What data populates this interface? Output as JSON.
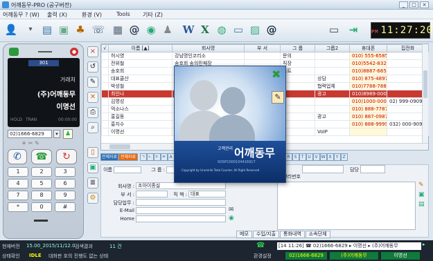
{
  "window": {
    "title": "어깨동무-PRO (공구버전)",
    "controls": [
      "_",
      "□",
      "×"
    ]
  },
  "menu": [
    {
      "label": "어깨동무 ? (W)"
    },
    {
      "label": "출력 (X)"
    },
    {
      "label": "환경 (V)"
    },
    {
      "label": "Tools"
    },
    {
      "label": "기타 (Z)"
    }
  ],
  "toolbar": {
    "clock": {
      "ampm": "PM",
      "time": "11:27:20"
    }
  },
  "phone": {
    "line": "301",
    "state": "거래처",
    "company": "(주)어깨동무",
    "contact": "이명선",
    "hold": "HOLD",
    "tran": "TRAN",
    "timer": "00:00:00",
    "number": "02)1666-6829",
    "keys": [
      "1",
      "2",
      "3",
      "4",
      "5",
      "6",
      "7",
      "8",
      "9",
      "*",
      "0",
      "#"
    ]
  },
  "grid": {
    "columns": [
      "√",
      "이름 [▲]",
      "회사명",
      "부 서",
      "그 룹",
      "그룹2",
      "휴대폰",
      "집전화"
    ],
    "rows": [
      {
        "name": "허시영",
        "company": "강남명인코리소",
        "dept": "",
        "group": "문의",
        "group2": "",
        "mobile": "010) 555-6585",
        "home": ""
      },
      {
        "name": "전위철",
        "company": "송호회 송의민패장",
        "dept": "",
        "group": "직장",
        "group2": "",
        "mobile": "010)5542-8323",
        "home": ""
      },
      {
        "name": "송호희",
        "company": "",
        "dept": "",
        "group": "트트",
        "group2": "",
        "mobile": "010)8887-6654",
        "home": ""
      },
      {
        "name": "대표클산",
        "company": "",
        "dept": "",
        "group": "",
        "group2": "상담",
        "mobile": "010) 875-4897",
        "home": ""
      },
      {
        "name": "박성철",
        "company": "",
        "dept": "",
        "group": "",
        "group2": "협력업체",
        "mobile": "010)7788-7887",
        "home": ""
      },
      {
        "name": "최인나",
        "company": "",
        "dept": "",
        "group": "",
        "group2": "광고",
        "mobile": "010)8989-0001",
        "home": "",
        "selected": true
      },
      {
        "name": "김명성",
        "company": "",
        "dept": "",
        "group": "",
        "group2": "",
        "mobile": "010)1000-0008",
        "home": "02) 999-0909"
      },
      {
        "name": "먹소나스",
        "company": "",
        "dept": "",
        "group": "",
        "group2": "",
        "mobile": "010) 888-7787",
        "home": ""
      },
      {
        "name": "홍길동",
        "company": "",
        "dept": "",
        "group": "",
        "group2": "광고",
        "mobile": "010) 887-0987",
        "home": ""
      },
      {
        "name": "홍지수",
        "company": "",
        "dept": "",
        "group": "",
        "group2": "",
        "mobile": "010) 888-9999",
        "home": "032) 000-9090"
      },
      {
        "name": "이명선",
        "company": "",
        "dept": "",
        "group": "",
        "group2": "VoIP",
        "mobile": "",
        "home": ""
      }
    ]
  },
  "filters": {
    "all": "전체자료",
    "all2": "전체자료",
    "letters": [
      "ㄱ",
      "ㄴ",
      "ㄷ",
      "ㄹ",
      "A",
      "B",
      "C",
      "D",
      "E",
      "F",
      "G",
      "H",
      "I",
      "J",
      "K",
      "L",
      "M",
      "N",
      "O",
      "P",
      "Q",
      "R",
      "S",
      "T",
      "U",
      "V",
      "W",
      "X",
      "Y",
      "Z"
    ]
  },
  "detail": {
    "name_label": "이름",
    "group_label": "그 룹 :",
    "company_label": "회사명 :",
    "company_value": "조아이종실",
    "dept_label": "부 서 :",
    "title_label": "직 책 :",
    "title_value": "대표",
    "task_label": "담당업무 :",
    "email_label": "E-Mail",
    "home_label": "Home",
    "rank_label": "직위",
    "code_label": "관리번호",
    "manager_label": "담당"
  },
  "tabs": [
    "메모",
    "수입/지출",
    "통화내역",
    "소속단체"
  ],
  "status": {
    "version_label": "현재버전",
    "version": "15.00_2015/11/12.0",
    "count_label": "검색결과",
    "count": "11 건",
    "state_label": "상태확인",
    "state": "IDLE",
    "state_msg": "대화판 호의 진행도 없는 상태",
    "setting": "환경설정",
    "call_log": "[14 11:26] ☎ 02)1666-6829 ▸ 이명선 ▸ (주)어깨동무",
    "line_number": "02)1666-6829",
    "line_company": "(주)어깨동무",
    "line_contact": "이명선"
  },
  "splash": {
    "small": "고객관리",
    "title": "어깨동무",
    "code": "SOSP1000104416917",
    "copyright": "Copyright by Uruminfo Total Counter. All Right Reserved"
  },
  "colors": {
    "selected_row": "#c9392f",
    "splash": "#1e4f9a"
  }
}
